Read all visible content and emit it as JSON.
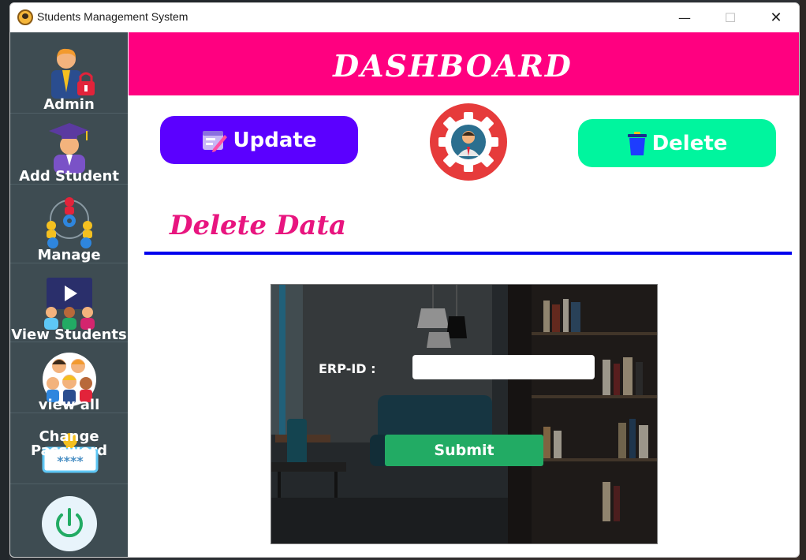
{
  "window": {
    "title": "Students Management System",
    "controls": {
      "minimize": "—",
      "maximize": "☐",
      "close": "✕"
    }
  },
  "sidebar": {
    "items": [
      {
        "label": "Admin",
        "icon": "admin-lock-icon"
      },
      {
        "label": "Add Student",
        "icon": "graduate-icon"
      },
      {
        "label": "Manage",
        "icon": "manage-team-gear-icon"
      },
      {
        "label": "View Students",
        "icon": "video-students-icon"
      },
      {
        "label": "view all",
        "icon": "students-group-icon"
      },
      {
        "label": "Change Password",
        "label_line1": "Change",
        "label_line2": "Password",
        "icon": "password-field-icon"
      }
    ],
    "power_icon": "power-icon"
  },
  "header": {
    "title": "DASHBOARD"
  },
  "actions": {
    "update_label": "Update",
    "delete_label": "Delete"
  },
  "section": {
    "title": "Delete Data"
  },
  "form": {
    "erp_label": "ERP-ID :",
    "erp_value": "",
    "submit_label": "Submit"
  },
  "colors": {
    "header_bg": "#ff0080",
    "sidebar_bg": "#3e4c52",
    "update_bg": "#5b00ff",
    "delete_bg": "#00f59e",
    "section_title": "#e8157f",
    "rule": "#0000ee",
    "submit_bg": "#22ab64"
  }
}
